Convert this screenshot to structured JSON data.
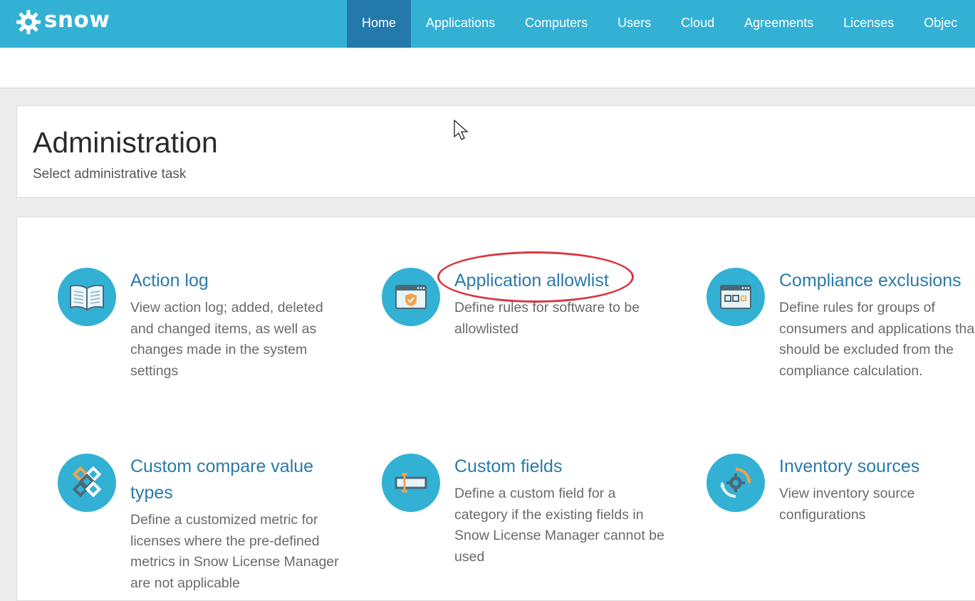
{
  "brand": {
    "name": "snow"
  },
  "nav": {
    "items": [
      {
        "label": "Home",
        "active": true
      },
      {
        "label": "Applications"
      },
      {
        "label": "Computers"
      },
      {
        "label": "Users"
      },
      {
        "label": "Cloud"
      },
      {
        "label": "Agreements"
      },
      {
        "label": "Licenses"
      },
      {
        "label": "Objec"
      }
    ]
  },
  "page": {
    "title": "Administration",
    "subtitle": "Select administrative task"
  },
  "tasks": [
    {
      "title": "Action log",
      "description": "View action log; added, deleted and changed items, as well as changes made in the system settings",
      "icon": "book-icon"
    },
    {
      "title": "Application allowlist",
      "description": "Define rules for software to be allowlisted",
      "icon": "shield-window-icon"
    },
    {
      "title": "Compliance exclusions",
      "description": "Define rules for groups of consumers and applications that should be excluded from the compliance calculation.",
      "icon": "window-boxes-icon"
    },
    {
      "title": "Custom compare value types",
      "description": "Define a customized metric for licenses where the pre-defined metrics in Snow License Manager are not applicable",
      "icon": "diamonds-icon"
    },
    {
      "title": "Custom fields",
      "description": "Define a custom field for a category if the existing fields in Snow License Manager cannot be used",
      "icon": "text-field-icon"
    },
    {
      "title": "Inventory sources",
      "description": "View inventory source configurations",
      "icon": "gear-sync-icon"
    }
  ],
  "colors": {
    "brand": "#33b1d4",
    "nav_active": "#2479ab",
    "link": "#2a7aa9",
    "highlight": "#d7373e"
  }
}
